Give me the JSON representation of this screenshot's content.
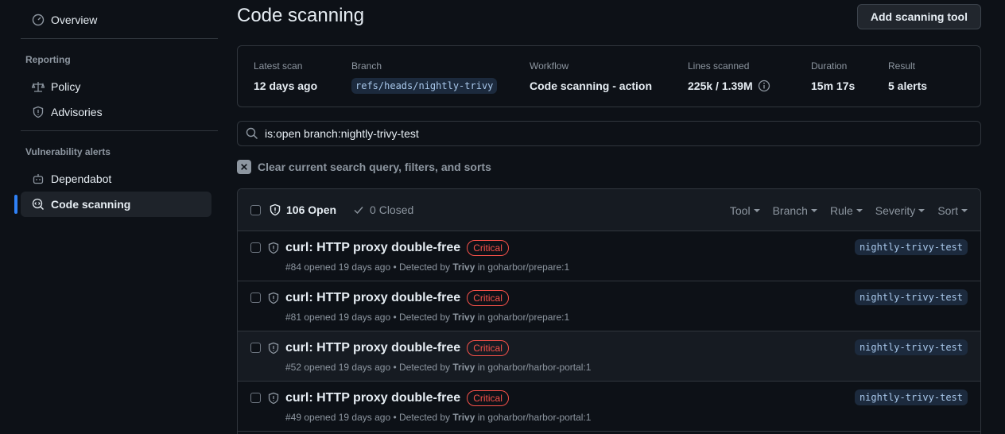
{
  "sidebar": {
    "overview_label": "Overview",
    "reporting_heading": "Reporting",
    "policy_label": "Policy",
    "advisories_label": "Advisories",
    "vuln_heading": "Vulnerability alerts",
    "dependabot_label": "Dependabot",
    "code_scanning_label": "Code scanning"
  },
  "header": {
    "title": "Code scanning",
    "add_button": "Add scanning tool"
  },
  "scan": {
    "latest_label": "Latest scan",
    "latest_value": "12 days ago",
    "branch_label": "Branch",
    "branch_value": "refs/heads/nightly-trivy",
    "workflow_label": "Workflow",
    "workflow_value": "Code scanning - action",
    "lines_label": "Lines scanned",
    "lines_value": "225k / 1.39M",
    "duration_label": "Duration",
    "duration_value": "15m 17s",
    "result_label": "Result",
    "result_value": "5 alerts"
  },
  "search": {
    "value": "is:open branch:nightly-trivy-test"
  },
  "clear_label": "Clear current search query, filters, and sorts",
  "alerts": {
    "open_label": "106 Open",
    "closed_label": "0 Closed",
    "filters": [
      "Tool",
      "Branch",
      "Rule",
      "Severity",
      "Sort"
    ],
    "rows": [
      {
        "title": "curl: HTTP proxy double-free",
        "severity": "Critical",
        "meta_prefix": "#84 opened 19 days ago • Detected by ",
        "tool": "Trivy",
        "meta_suffix": " in goharbor/prepare:1",
        "branch": "nightly-trivy-test"
      },
      {
        "title": "curl: HTTP proxy double-free",
        "severity": "Critical",
        "meta_prefix": "#81 opened 19 days ago • Detected by ",
        "tool": "Trivy",
        "meta_suffix": " in goharbor/prepare:1",
        "branch": "nightly-trivy-test"
      },
      {
        "title": "curl: HTTP proxy double-free",
        "severity": "Critical",
        "meta_prefix": "#52 opened 19 days ago • Detected by ",
        "tool": "Trivy",
        "meta_suffix": " in goharbor/harbor-portal:1",
        "branch": "nightly-trivy-test"
      },
      {
        "title": "curl: HTTP proxy double-free",
        "severity": "Critical",
        "meta_prefix": "#49 opened 19 days ago • Detected by ",
        "tool": "Trivy",
        "meta_suffix": " in goharbor/harbor-portal:1",
        "branch": "nightly-trivy-test"
      }
    ]
  },
  "colors": {
    "accent": "#2f81f7",
    "link": "#4493f8",
    "critical": "#f85149"
  }
}
